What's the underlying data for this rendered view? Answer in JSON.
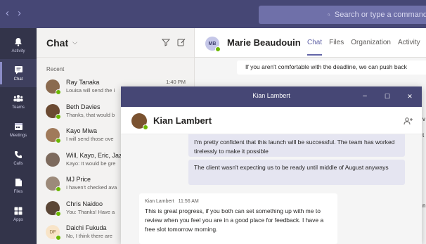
{
  "topbar": {
    "back_icon": "chevron-left-icon",
    "forward_icon": "chevron-right-icon",
    "search_placeholder": "Search or type a command"
  },
  "rail": {
    "items": [
      {
        "label": "Activity",
        "icon": "bell-icon"
      },
      {
        "label": "Chat",
        "icon": "chat-icon"
      },
      {
        "label": "Teams",
        "icon": "teams-icon"
      },
      {
        "label": "Meetings",
        "icon": "calendar-icon"
      },
      {
        "label": "Calls",
        "icon": "phone-icon"
      },
      {
        "label": "Files",
        "icon": "file-icon"
      },
      {
        "label": "Apps",
        "icon": "apps-icon"
      }
    ]
  },
  "chatlist": {
    "title": "Chat",
    "chevron": "⌵",
    "recent_label": "Recent",
    "items": [
      {
        "name": "Ray Tanaka",
        "preview": "Louisa will send the i",
        "time": "1:40 PM",
        "avatar_color": "#8a6a4f",
        "online": true
      },
      {
        "name": "Beth Davies",
        "preview": "Thanks, that would b",
        "time": "",
        "avatar_color": "#6b4a32",
        "online": true
      },
      {
        "name": "Kayo Miwa",
        "preview": "I will send those ove",
        "time": "",
        "avatar_color": "#a07a5a",
        "online": true
      },
      {
        "name": "Will, Kayo, Eric, Jaz",
        "preview": "Kayo: It would be gre",
        "time": "",
        "avatar_color": "#7d6a5d",
        "online": false
      },
      {
        "name": "MJ Price",
        "preview": "I haven't checked ava",
        "time": "",
        "avatar_color": "#9c8a7a",
        "online": true
      },
      {
        "name": "Chris Naidoo",
        "preview": "You: Thanks! Have a",
        "time": "",
        "avatar_color": "#5a4636",
        "online": true
      },
      {
        "name": "Daichi Fukuda",
        "preview": "No, I think there are",
        "time": "",
        "avatar_initials": "DF",
        "online": true
      }
    ]
  },
  "main": {
    "avatar_initials": "MB",
    "name": "Marie Beaudouin",
    "tabs": [
      {
        "label": "Chat",
        "active": true
      },
      {
        "label": "Files",
        "active": false
      },
      {
        "label": "Organization",
        "active": false
      },
      {
        "label": "Activity",
        "active": false
      }
    ],
    "message": "If you aren't comfortable with the deadline, we can push back",
    "peek_1": "v",
    "peek_2": "t",
    "peek_3": "n"
  },
  "popout": {
    "window_title": "Kian Lambert",
    "minimize": "–",
    "maximize": "☐",
    "close": "✕",
    "name": "Kian Lambert",
    "messages_me": [
      "I'm pretty confident that this launch will be successful. The team has worked tirelessly to make it possible",
      "The client wasn't expecting us to be ready until middle of August anyways"
    ],
    "message_other": {
      "sender": "Kian Lambert",
      "time": "11:56 AM",
      "text": "This is great progress, if you both can set something up with me to review when you feel you are in a good place for feedback. I have a free slot tomorrow morning."
    }
  },
  "colors": {
    "brand": "#464775",
    "accent": "#6264a7",
    "online": "#6bb700"
  }
}
